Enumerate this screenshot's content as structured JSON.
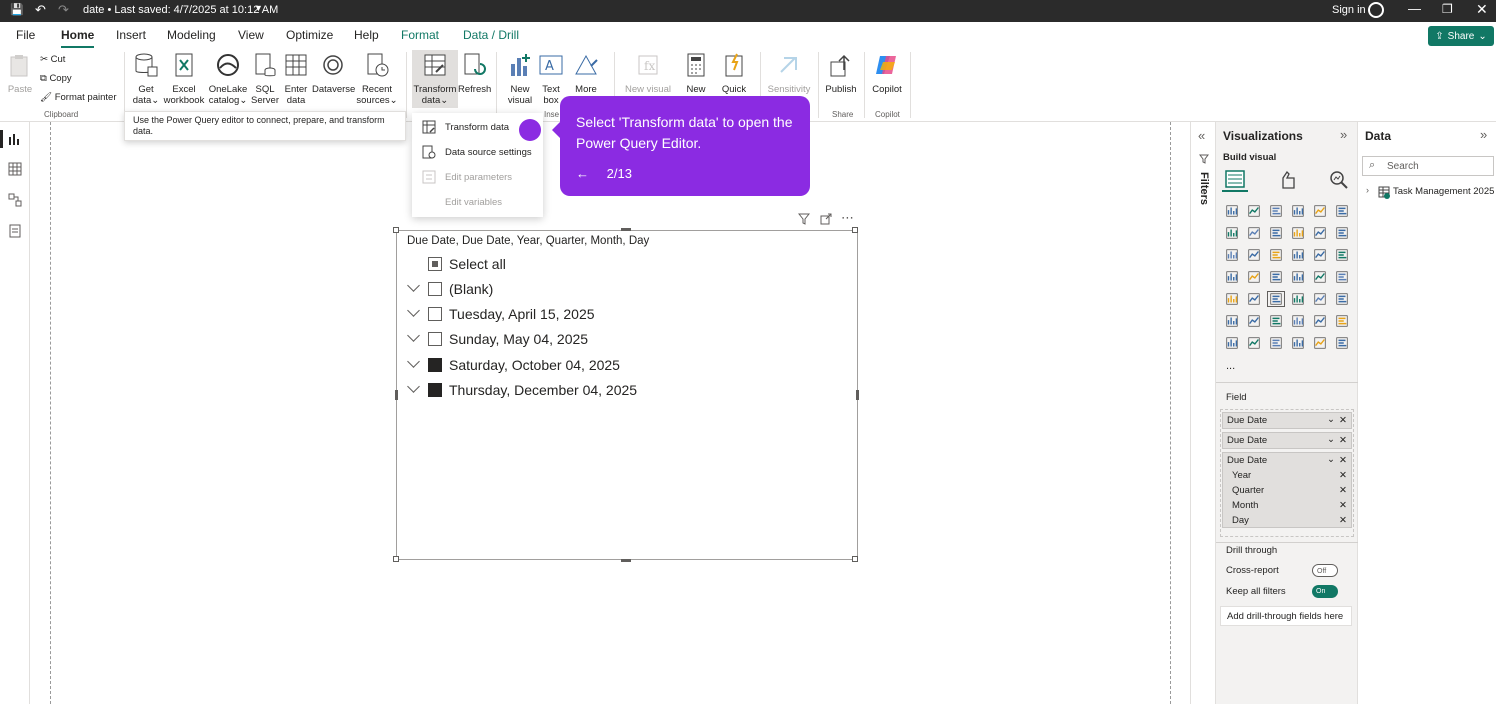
{
  "titlebar": {
    "doc_title": "date • Last saved: 4/7/2025 at 10:12 AM",
    "signin": "Sign in"
  },
  "tabs": [
    "File",
    "Home",
    "Insert",
    "Modeling",
    "View",
    "Optimize",
    "Help",
    "Format",
    "Data / Drill"
  ],
  "share_label": "Share",
  "ribbon": {
    "paste": "Paste",
    "cut": "Cut",
    "copy": "Copy",
    "format_painter": "Format painter",
    "clipboard_group": "Clipboard",
    "get_data": [
      "Get",
      "data"
    ],
    "excel": [
      "Excel",
      "workbook"
    ],
    "onelake": [
      "OneLake",
      "catalog"
    ],
    "sql": [
      "SQL",
      "Server"
    ],
    "enter": [
      "Enter",
      "data"
    ],
    "dataverse": "Dataverse",
    "recent": [
      "Recent",
      "sources"
    ],
    "transform": [
      "Transform",
      "data"
    ],
    "refresh": "Refresh",
    "new_visual": [
      "New",
      "visual"
    ],
    "text_box": [
      "Text",
      "box"
    ],
    "more": "More",
    "new_visual_dis": "New visual",
    "new": "New",
    "quick": "Quick",
    "sensitivity": "Sensitivity",
    "publish": "Publish",
    "copilot": "Copilot",
    "share_group": "Share",
    "copilot_group": "Copilot",
    "insert_group": "Inse"
  },
  "tooltip": "Use the Power Query editor to connect, prepare, and transform data.",
  "dropdown": {
    "items": [
      {
        "label": "Transform data",
        "enabled": true
      },
      {
        "label": "Data source settings",
        "enabled": true
      },
      {
        "label": "Edit parameters",
        "enabled": false
      },
      {
        "label": "Edit variables",
        "enabled": false
      }
    ]
  },
  "callout": {
    "message": "Select 'Transform data' to open the Power Query Editor.",
    "back_arrow": "←",
    "step": "2/13",
    "color": "#8b2be2"
  },
  "slicer": {
    "header": "Due Date, Due Date, Year, Quarter, Month, Day",
    "select_all": "Select all",
    "rows": [
      {
        "label": "(Blank)",
        "checked": false
      },
      {
        "label": "Tuesday, April 15, 2025",
        "checked": false
      },
      {
        "label": "Sunday, May 04, 2025",
        "checked": false
      },
      {
        "label": "Saturday, October 04, 2025",
        "checked": true
      },
      {
        "label": "Thursday, December 04, 2025",
        "checked": true
      }
    ]
  },
  "filters_label": "Filters",
  "visualizations": {
    "title": "Visualizations",
    "build_visual": "Build visual",
    "more": "...",
    "field_label": "Field",
    "wells": [
      "Due Date",
      "Due Date",
      "Due Date"
    ],
    "hierarchy": [
      "Year",
      "Quarter",
      "Month",
      "Day"
    ],
    "drill_through": "Drill through",
    "cross_report": "Cross-report",
    "cross_report_state": "Off",
    "keep_all_filters": "Keep all filters",
    "keep_state": "On",
    "add_drill": "Add drill-through fields here"
  },
  "data_pane": {
    "title": "Data",
    "search_placeholder": "Search",
    "table": "Task Management 2025"
  },
  "colors": {
    "accent": "#117865",
    "callout": "#8b2be2",
    "titlebar": "#2b2b2b"
  }
}
